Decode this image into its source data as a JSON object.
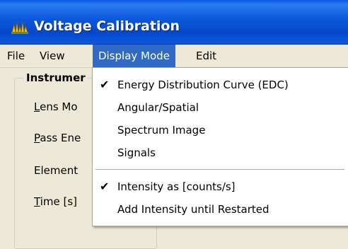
{
  "window": {
    "title": "Voltage Calibration",
    "icon": "instrument-app-icon",
    "title_bar_color": "#0a5ae0"
  },
  "menubar": {
    "items": [
      {
        "label": "File"
      },
      {
        "label": "View"
      },
      {
        "label": "Display Mode",
        "active": true
      },
      {
        "label": "Edit"
      }
    ],
    "highlight_color": "#316ac5"
  },
  "panel": {
    "group_title": "Instrumer",
    "fields": [
      {
        "label_underlined": "L",
        "label_rest": "ens Mo"
      },
      {
        "label_underlined": "P",
        "label_rest": "ass Ene"
      },
      {
        "label_underlined": "",
        "label_rest": "Element"
      },
      {
        "label_underlined": "T",
        "label_rest": "ime [s]"
      }
    ]
  },
  "dropdown": {
    "items": [
      {
        "label": "Energy Distribution Curve (EDC)",
        "checked": true
      },
      {
        "label": "Angular/Spatial",
        "checked": false
      },
      {
        "label": "Spectrum Image",
        "checked": false
      },
      {
        "label": "Signals",
        "checked": false
      },
      {
        "label": "Intensity as [counts/s]",
        "checked": true
      },
      {
        "label": "Add Intensity until Restarted",
        "checked": false
      }
    ],
    "check_glyph": "✔"
  }
}
